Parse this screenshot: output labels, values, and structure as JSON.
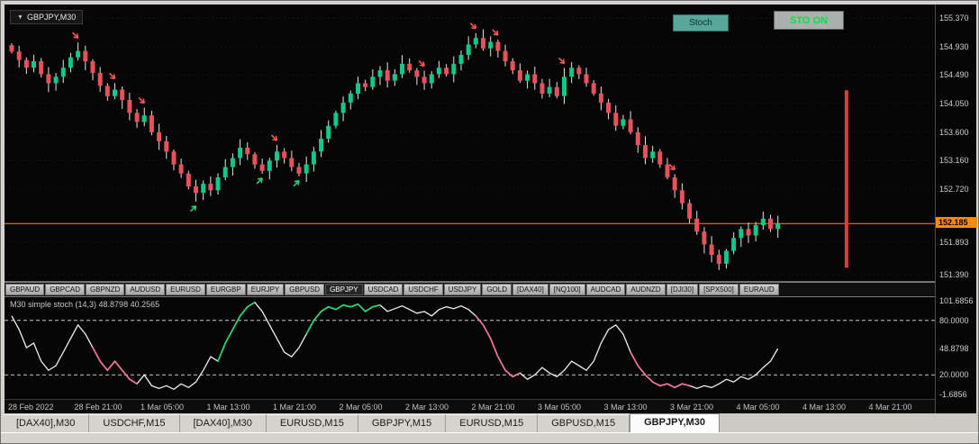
{
  "chart": {
    "symbol_chip": "GBPJPY,M30",
    "stoch_button": "Stoch",
    "sto_on_button": "STO ON",
    "price_range": [
      151.28,
      155.58
    ],
    "colors": {
      "bull": "#0ec98a",
      "bear": "#e8505b",
      "wick": "#e4e4e4",
      "grid": "#1e1e1e",
      "hline": "#ff8a00"
    },
    "price_axis": {
      "labels": [
        {
          "text": "155.370",
          "price": 155.37
        },
        {
          "text": "154.930",
          "price": 154.93
        },
        {
          "text": "154.490",
          "price": 154.49
        },
        {
          "text": "154.050",
          "price": 154.05
        },
        {
          "text": "153.600",
          "price": 153.6
        },
        {
          "text": "153.160",
          "price": 153.16
        },
        {
          "text": "152.720",
          "price": 152.72
        },
        {
          "text": "151.893",
          "price": 151.893
        },
        {
          "text": "151.390",
          "price": 151.39
        }
      ],
      "current": {
        "text": "152.185",
        "price": 152.185,
        "color": "#ff8a00"
      }
    },
    "candles": {
      "first_open": 154.95,
      "spacing": 8.18,
      "closes": [
        154.85,
        154.72,
        154.6,
        154.7,
        154.5,
        154.36,
        154.46,
        154.6,
        154.76,
        154.86,
        154.7,
        154.52,
        154.32,
        154.16,
        154.26,
        154.1,
        153.9,
        153.76,
        153.86,
        153.6,
        153.46,
        153.3,
        153.1,
        152.96,
        152.76,
        152.66,
        152.8,
        152.7,
        152.9,
        153.06,
        153.2,
        153.36,
        153.26,
        153.1,
        153.0,
        153.16,
        153.3,
        153.2,
        153.06,
        152.96,
        153.1,
        153.3,
        153.5,
        153.7,
        153.9,
        154.06,
        154.2,
        154.36,
        154.3,
        154.46,
        154.56,
        154.4,
        154.5,
        154.66,
        154.56,
        154.46,
        154.36,
        154.5,
        154.6,
        154.5,
        154.66,
        154.8,
        154.96,
        155.06,
        154.9,
        155.0,
        154.86,
        154.7,
        154.56,
        154.4,
        154.5,
        154.36,
        154.2,
        154.3,
        154.16,
        154.46,
        154.6,
        154.5,
        154.36,
        154.2,
        154.06,
        153.9,
        153.7,
        153.8,
        153.6,
        153.4,
        153.2,
        153.3,
        153.1,
        152.9,
        152.7,
        152.5,
        152.26,
        152.06,
        151.86,
        151.7,
        151.56,
        151.76,
        151.96,
        152.1,
        152.0,
        152.16,
        152.26,
        152.1,
        152.185
      ]
    },
    "markers": {
      "sell": [
        9,
        14,
        18,
        36,
        56,
        63,
        66,
        75,
        90
      ],
      "buy": [
        25,
        34,
        39
      ],
      "sell_color": "#ff5252",
      "buy_color": "#2ecc71"
    },
    "vline": {
      "x_frac": 0.905,
      "from": 154.25,
      "to": 151.5,
      "color": "#e53935"
    }
  },
  "symbol_strip": {
    "active": "GBPJPY",
    "items": [
      "GBPAUD",
      "GBPCAD",
      "GBPNZD",
      "AUDUSD",
      "EURUSD",
      "EURGBP",
      "EURJPY",
      "GBPUSD",
      "GBPJPY",
      "USDCAD",
      "USDCHF",
      "USDJPY",
      "GOLD",
      "[DAX40]",
      "[NQ100]",
      "AUDCAD",
      "AUDNZD",
      "[DJI30]",
      "[SPX500]",
      "EURAUD"
    ]
  },
  "stoch": {
    "label": "M30  simple stoch (14,3) 48.8798 40.2565",
    "levels": [
      80,
      20
    ],
    "line_color": "#f0f0f0",
    "green_color": "#2bd96f",
    "pink_color": "#f0739f",
    "axis_labels": [
      {
        "text": "101.6856",
        "value": 101.6856
      },
      {
        "text": "80.0000",
        "value": 80
      },
      {
        "text": "48.8798",
        "value": 48.8798
      },
      {
        "text": "20.0000",
        "value": 20
      },
      {
        "text": "-1.6856",
        "value": -1.6856
      }
    ],
    "green_segments": [
      [
        28,
        33
      ],
      [
        40,
        50
      ]
    ],
    "pink_segments": [
      [
        11,
        17
      ],
      [
        63,
        69
      ],
      [
        84,
        92
      ]
    ],
    "values": [
      85,
      70,
      50,
      55,
      35,
      25,
      30,
      45,
      60,
      75,
      65,
      50,
      35,
      25,
      35,
      25,
      15,
      10,
      20,
      8,
      5,
      8,
      4,
      10,
      6,
      12,
      25,
      40,
      35,
      55,
      70,
      85,
      95,
      100,
      90,
      75,
      60,
      45,
      40,
      50,
      65,
      80,
      90,
      95,
      92,
      97,
      95,
      98,
      90,
      95,
      97,
      90,
      93,
      96,
      92,
      88,
      90,
      85,
      92,
      95,
      93,
      96,
      92,
      85,
      75,
      60,
      40,
      25,
      18,
      22,
      15,
      20,
      28,
      22,
      18,
      25,
      35,
      30,
      25,
      35,
      55,
      70,
      75,
      65,
      45,
      30,
      20,
      12,
      8,
      10,
      6,
      10,
      8,
      5,
      8,
      6,
      10,
      15,
      12,
      18,
      15,
      20,
      28,
      35,
      48.88
    ]
  },
  "time_axis": {
    "labels": [
      "28 Feb 2022",
      "28 Feb 21:00",
      "1 Mar 05:00",
      "1 Mar 13:00",
      "1 Mar 21:00",
      "2 Mar 05:00",
      "2 Mar 13:00",
      "2 Mar 21:00",
      "3 Mar 05:00",
      "3 Mar 13:00",
      "3 Mar 21:00",
      "4 Mar 05:00",
      "4 Mar 13:00",
      "4 Mar 21:00"
    ]
  },
  "bottom_tabs": {
    "active_index": 7,
    "tabs": [
      {
        "label": "[DAX40],M30"
      },
      {
        "label": "USDCHF,M15"
      },
      {
        "label": "[DAX40],M30"
      },
      {
        "label": "EURUSD,M15"
      },
      {
        "label": "GBPJPY,M15"
      },
      {
        "label": "EURUSD,M15"
      },
      {
        "label": "GBPUSD,M15"
      },
      {
        "label": "GBPJPY,M30"
      }
    ]
  }
}
